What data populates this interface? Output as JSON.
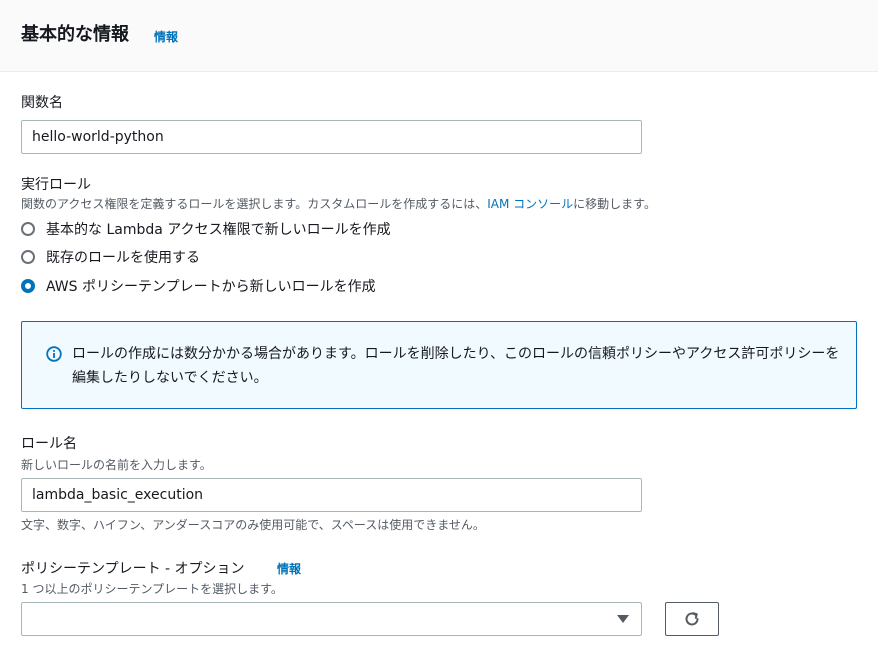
{
  "header": {
    "title": "基本的な情報",
    "info_link": "情報"
  },
  "function_name": {
    "label": "関数名",
    "value": "hello-world-python"
  },
  "execution_role": {
    "label": "実行ロール",
    "description_prefix": "関数のアクセス権限を定義するロールを選択します。カスタムロールを作成するには、",
    "description_link": "IAM コンソール",
    "description_suffix": "に移動します。",
    "options": [
      {
        "label": "基本的な Lambda アクセス権限で新しいロールを作成",
        "selected": false
      },
      {
        "label": "既存のロールを使用する",
        "selected": false
      },
      {
        "label": "AWS ポリシーテンプレートから新しいロールを作成",
        "selected": true
      }
    ]
  },
  "alert": {
    "message": "ロールの作成には数分かかる場合があります。ロールを削除したり、このロールの信頼ポリシーやアクセス許可ポリシーを編集したりしないでください。"
  },
  "role_name": {
    "label": "ロール名",
    "description": "新しいロールの名前を入力します。",
    "value": "lambda_basic_execution",
    "constraint": "文字、数字、ハイフン、アンダースコアのみ使用可能で、スペースは使用できません。"
  },
  "policy_templates": {
    "label": "ポリシーテンプレート - オプション",
    "info_link": "情報",
    "description": "1 つ以上のポリシーテンプレートを選択します。",
    "selected_value": ""
  },
  "colors": {
    "link": "#0073bb",
    "alert_bg": "#f1faff",
    "alert_border": "#0073bb"
  },
  "icons": {
    "alert": "info-circle-icon",
    "select": "caret-down-icon",
    "refresh": "refresh-icon"
  }
}
